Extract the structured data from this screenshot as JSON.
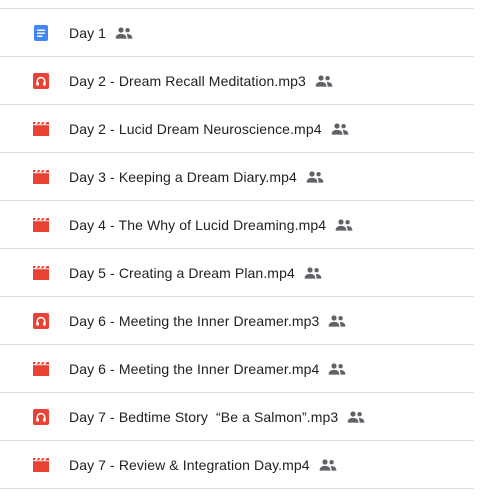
{
  "colors": {
    "doc_icon": "#4285f4",
    "audio_icon": "#ea4335",
    "video_icon": "#ea4335",
    "divider": "#dadce0",
    "text": "#202124",
    "shared_icon": "#5f6368"
  },
  "files": [
    {
      "name": "Day 1",
      "type_icon": "google-docs-icon",
      "shared": true
    },
    {
      "name": "Day 2 - Dream Recall Meditation.mp3",
      "type_icon": "audio-file-icon",
      "shared": true
    },
    {
      "name": "Day 2 - Lucid Dream Neuroscience.mp4",
      "type_icon": "video-file-icon",
      "shared": true
    },
    {
      "name": "Day 3 - Keeping a Dream Diary.mp4",
      "type_icon": "video-file-icon",
      "shared": true
    },
    {
      "name": "Day 4 - The Why of Lucid Dreaming.mp4",
      "type_icon": "video-file-icon",
      "shared": true
    },
    {
      "name": "Day 5 - Creating a Dream Plan.mp4",
      "type_icon": "video-file-icon",
      "shared": true
    },
    {
      "name": "Day 6 - Meeting the Inner Dreamer.mp3",
      "type_icon": "audio-file-icon",
      "shared": true
    },
    {
      "name": "Day 6 - Meeting the Inner Dreamer.mp4",
      "type_icon": "video-file-icon",
      "shared": true
    },
    {
      "name": "Day 7 - Bedtime Story  “Be a Salmon”.mp3",
      "type_icon": "audio-file-icon",
      "shared": true
    },
    {
      "name": "Day 7 - Review & Integration Day.mp4",
      "type_icon": "video-file-icon",
      "shared": true
    }
  ]
}
